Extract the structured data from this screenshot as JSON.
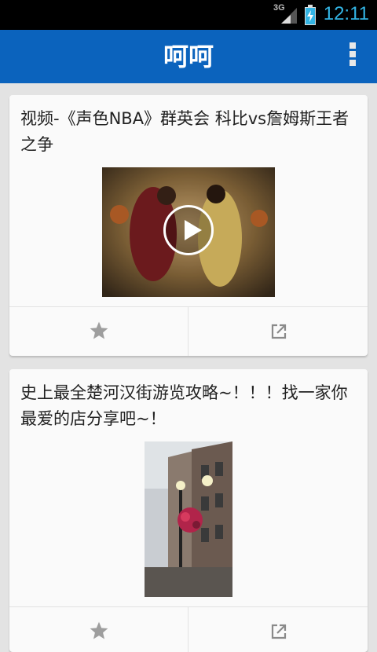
{
  "status_bar": {
    "network": "3G",
    "time": "12:11",
    "signal_icon": "signal-icon",
    "battery_icon": "battery-charging-icon",
    "accent_color": "#33b5e5"
  },
  "action_bar": {
    "title": "呵呵",
    "overflow_icon": "overflow-menu-icon",
    "background": "#0b63bd"
  },
  "feed": [
    {
      "title": "视频-《声色NBA》群英会 科比vs詹姆斯王者之争",
      "media_type": "video",
      "play_icon": "play-icon",
      "favorite_icon": "star-icon",
      "share_icon": "open-external-icon"
    },
    {
      "title": "史上最全楚河汉街游览攻略~！！！找一家你最爱的店分享吧~！",
      "media_type": "image",
      "favorite_icon": "star-icon",
      "share_icon": "open-external-icon"
    }
  ]
}
